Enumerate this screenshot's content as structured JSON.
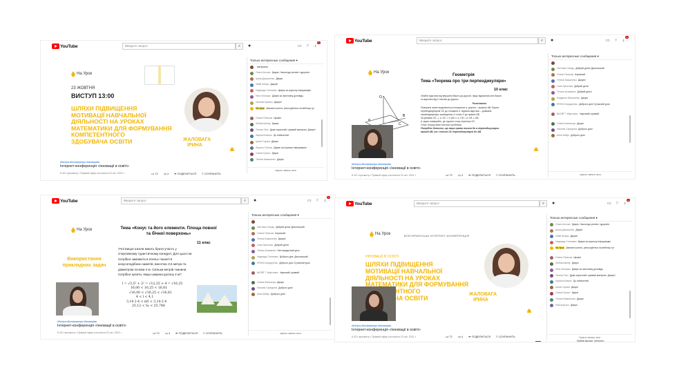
{
  "youtube": {
    "logo_text": "YouTube",
    "search_placeholder": "Введите запрос",
    "chat_filter": "Только интересные сообщения",
    "chat_hide": "скрыть запись чата",
    "chat_hide_alt": "Скрыть запись чата",
    "actions": {
      "likes": "72",
      "dislikes": "4",
      "share": "ПОДЕЛИТЬСЯ",
      "save": "СОХРАНИТЬ"
    },
    "tags": "#НаУрок #Конференція #Інноваціїво",
    "video_title": "Інтернет-конференція «Інновації в освіті»",
    "meta": "8 421 просмотр • Прямой эфир состоялся 23 окт. 2021 г.",
    "notif_badge": "9+"
  },
  "colors": {
    "accent_yellow": "#f2b705",
    "yt_red": "#ff0000",
    "link_blue": "#065fd4"
  },
  "shots": {
    "s1": {
      "brand": "На Урок",
      "date": "23 ЖОВТНЯ",
      "time": "ВИСТУП 13:00",
      "headline": [
        "ШЛЯХИ ПІДВИЩЕННЯ",
        "МОТИВАЦІЇ НАВЧАЛЬНОЇ",
        "ДІЯЛЬНОСТІ НА УРОКАХ",
        "МАТЕМАТИКИ ДЛЯ ФОРМУВАННЯ",
        "КОМПЕТЕНТНОГО",
        "ЗДОБУВАЧА ОСВІТИ"
      ],
      "speaker": [
        "ЖАЛОВАГА",
        "ІРИНА"
      ],
      "chat": [
        {
          "name": "",
          "text": "матеріали",
          "color": "#7a4a3a"
        },
        {
          "name": "Ольга Колчан",
          "text": "Дякую. Насолоди успіхів і здоров'я",
          "color": "#6d8a4e"
        },
        {
          "name": "Ірина Дорошенко",
          "text": "Дякую",
          "color": "#b07050"
        },
        {
          "name": "Vitalii Sulbya",
          "text": "Дякую!",
          "color": "#5071b0"
        },
        {
          "name": "Надежда Степанюк",
          "text": "Дякую за корисну інформацію",
          "color": "#c46060"
        },
        {
          "name": "Ніна Чепишко",
          "text": "Дякую за змістовну доповідь",
          "color": "#8a5a9a"
        },
        {
          "name": "Наталія Брижко",
          "text": "Дякую!",
          "color": "#b0a040"
        },
        {
          "name": "На Урок",
          "text": "Шановні колеги, реєструйтеся на вебінар тут",
          "color": "#f2b705"
        },
        {
          "name": "Олена Пальчик",
          "text": "Цікаво!",
          "color": "#a06060"
        },
        {
          "name": "Любов Шкляр",
          "text": "Дякую",
          "color": "#507050"
        },
        {
          "name": "Тетяна Ткач",
          "text": "Дуже корисний і цікавий матеріал. Дякую!",
          "color": "#705080"
        },
        {
          "name": "Лариса Коваль",
          "text": "До побачення!",
          "color": "#3d7a9a"
        },
        {
          "name": "Ірина Сорока",
          "text": "Дякую",
          "color": "#9a6a3a"
        },
        {
          "name": "Лариса Сітенко",
          "text": "Дякую за корисну інформацію",
          "color": "#6a6a9a"
        },
        {
          "name": "Олена Гунько",
          "text": "Дякую",
          "color": "#9a3a5a"
        },
        {
          "name": "Тетяна Бакшеєнко",
          "text": "Дякую",
          "color": "#4a8a6a"
        }
      ]
    },
    "s2": {
      "brand": "На Урок",
      "subject": "Геометрія",
      "topic": "Тема «Теорема про три перпендикуляри»",
      "grade": "10 клас",
      "body": [
        "Знайти відстань від вершини башти до дороги, якщо відома висота башти",
        "та відстань від її основи до дороги.",
        "Розв'язання",
        "Поверхня землі моделюється площиною α, дорога – прямою AB, башта",
        "перпендикуляром OC до площини α. Шукана відстань – довжина",
        "перпендикуляра, проведеного з точки O до прямої AB.",
        "За умовою OC ⊥ α, OC = h, AB ⊂ α, CB = d, CB ⊥ AB.",
        "А зараз поміркуйте, де шукати точку перетину OC",
        "Отже, перед нами постала проблема.",
        "Потрібно довести, що якщо пряма похила до α перпендикулярна",
        "прямій AB, то і похила OC перпендикулярна до AB."
      ],
      "labels": {
        "o": "O",
        "a": "A",
        "b": "B",
        "c": "C",
        "alpha": "α"
      },
      "chat": [
        {
          "name": "",
          "text": "",
          "color": "#7a4a3a"
        },
        {
          "name": "Світлана Засідь",
          "text": "Добрий день! Дільниський",
          "color": "#6d8a4e"
        },
        {
          "name": "Олена Пальчик",
          "text": "Корисний",
          "color": "#b07050"
        },
        {
          "name": "Тетяна Бакшеєнко",
          "text": "Дякую!",
          "color": "#5071b0"
        },
        {
          "name": "Lana Syhovska",
          "text": "Добрий день!",
          "color": "#c46060"
        },
        {
          "name": "Тетяна Атаманюк",
          "text": "Добрий день!",
          "color": "#8a5a9a"
        },
        {
          "name": "Людмила Ніколаєнко",
          "text": "Дякую",
          "color": "#b0a040"
        },
        {
          "name": "ІРИНА Бондаренко",
          "text": "Доброго дня! Сучасний урок",
          "color": "#3d7a9a"
        },
        {
          "name": "ВАЛІЙ Т. Мартинюк",
          "text": "Науковий, цікавий",
          "color": "#a06060"
        },
        {
          "name": "Олена Ковальчук",
          "text": "Дякую",
          "color": "#507050"
        },
        {
          "name": "Наталія Середнюк",
          "text": "Доброго дня!",
          "color": "#705080"
        },
        {
          "name": "Анна Бабус",
          "text": "Доброго дня!",
          "color": "#9a6a3a"
        }
      ]
    },
    "s3": {
      "brand": "На Урок",
      "topic": [
        "Тема «Конус та його елементи. Площа повної",
        "та бічної поверхонь»"
      ],
      "grade": "11 клас",
      "side_title": [
        "Використання",
        "прикладних задач"
      ],
      "body": [
        "Учні вищої школи мають брати участь у",
        "спортивному туристичному конкурсі. Для цього їм",
        "потрібно замовити в ательє пошиття",
        "конусоподібних наметів, висотою 3,5 метра та",
        "діаметром основи 4 м. Скільки метрів тканини",
        "потрібно купити, якщо ширина рулону 2 м?"
      ],
      "formulas": [
        "l = √3,5² + 2² = √12,25 + 4 = √16,25",
        "16,00 < 16,25 < 16,81",
        "√16,00 < √16,25 < √16,81",
        "4 < l < 4,1",
        "3,14·2·4 < πrl < 3,14·2·4",
        "25,12 < S₆ < 25,748"
      ],
      "chat": [
        {
          "name": "",
          "text": "",
          "color": "#7a4a3a"
        },
        {
          "name": "Світлана Засідь",
          "text": "Добрий день! Дільниський",
          "color": "#6d8a4e"
        },
        {
          "name": "Олена Пальчик",
          "text": "Корисний",
          "color": "#b07050"
        },
        {
          "name": "Тетяна Бакшеєнко",
          "text": "Дякую!",
          "color": "#5071b0"
        },
        {
          "name": "Lana Syhovska",
          "text": "Добрий день!",
          "color": "#c46060"
        },
        {
          "name": "Тетяна Атаманюк",
          "text": "Нестандартний урок",
          "color": "#8a5a9a"
        },
        {
          "name": "Надежда Степанюк",
          "text": "Доброго дня. Дільниський",
          "color": "#b0a040"
        },
        {
          "name": "ІРИНА Бондаренко",
          "text": "Доброго дня! Сучасний урок",
          "color": "#3d7a9a"
        },
        {
          "name": "ВАЛІЙ Т. Мартинюк",
          "text": "Науковий, цікавий",
          "color": "#a06060"
        },
        {
          "name": "Олена Ковальчук",
          "text": "Дякую",
          "color": "#507050"
        },
        {
          "name": "Наталія Середнюк",
          "text": "Доброго дня!",
          "color": "#705080"
        },
        {
          "name": "Анна Бабус",
          "text": "Доброго дня!",
          "color": "#9a6a3a"
        }
      ]
    },
    "s4": {
      "brand": "На Урок",
      "conf": "ВСЕУКРАЇНСЬКА ІНТЕРНЕТ-КОНФЕРЕНЦІЯ",
      "innov": "ІННОВАЦІЇ В ОСВІТІ",
      "headline": [
        "ШЛЯХИ ПІДВИЩЕННЯ",
        "МОТИВАЦІЇ НАВЧАЛЬНОЇ",
        "ДІЯЛЬНОСТІ НА УРОКАХ",
        "МАТЕМАТИКИ ДЛЯ ФОРМУВАННЯ",
        "КОМПЕТЕНТНОГО",
        "ЗДОБУВАЧА ОСВІТИ"
      ],
      "speaker": [
        "ЖАЛОВАГА",
        "ІРИНА"
      ],
      "footer_name": "Любов Шкляр: Інтернет-",
      "chat": [
        {
          "name": "Ольга Колчан",
          "text": "Дякую. Насолоди успіхів і здоров'я",
          "color": "#6d8a4e"
        },
        {
          "name": "Ірина Дорошенко",
          "text": "Дякую",
          "color": "#b07050"
        },
        {
          "name": "Vitalii Sulbya",
          "text": "Дякую!",
          "color": "#5071b0"
        },
        {
          "name": "Надежда Степанюк",
          "text": "Дякую за корисну інформацію",
          "color": "#c46060"
        },
        {
          "name": "На Урок",
          "text": "Шановні колеги, реєструйтеся на вебінар тут",
          "color": "#f2b705"
        },
        {
          "name": "Олена Пальчик",
          "text": "Цікаво!",
          "color": "#a06060"
        },
        {
          "name": "Любов Шкляр",
          "text": "Дякую",
          "color": "#507050"
        },
        {
          "name": "Ніна Чепишко",
          "text": "Дякую за змістовну доповідь",
          "color": "#8a5a9a"
        },
        {
          "name": "Тетяна Ткач",
          "text": "Дуже корисний і цікавий матеріал. Дякую!",
          "color": "#705080"
        },
        {
          "name": "Лариса Коваль",
          "text": "До побачення!",
          "color": "#3d7a9a"
        },
        {
          "name": "Ірина Сорока",
          "text": "Дякую",
          "color": "#9a6a3a"
        },
        {
          "name": "Олена Гунько",
          "text": "Дякую",
          "color": "#9a3a5a"
        },
        {
          "name": "Тетяна Бакшеєнко",
          "text": "Дякую",
          "color": "#4a8a6a"
        },
        {
          "name": "Інна Крутько",
          "text": "Дякую",
          "color": "#6a6a9a"
        }
      ]
    }
  }
}
